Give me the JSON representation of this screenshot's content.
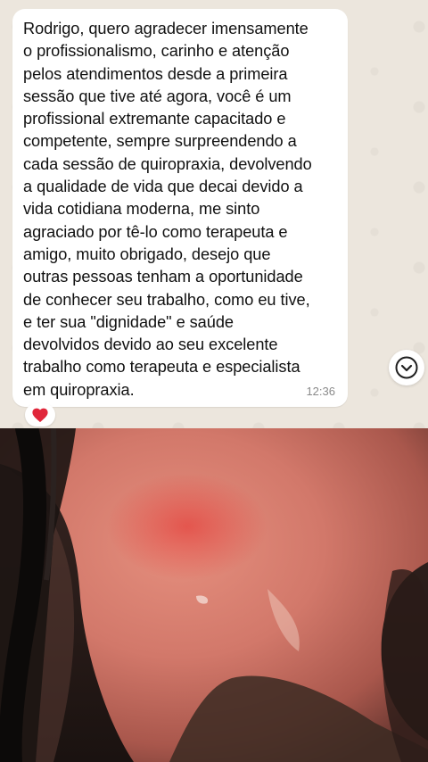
{
  "message": {
    "text": "Rodrigo, quero agradecer imensamente\no profissionalismo, carinho e atenção\npelos atendimentos desde a primeira\nsessão que tive até agora, você é um\nprofissional extremante capacitado e\ncompetente, sempre surpreendendo a\ncada sessão de quiropraxia, devolvendo\na qualidade de vida que decai devido a\nvida cotidiana moderna, me sinto\nagraciado por tê-lo como terapeuta e\namigo, muito obrigado, desejo que\noutras pessoas tenham a oportunidade\nde conhecer seu trabalho, como eu tive,\ne ter sua \"dignidade\" e saúde\ndevolvidos devido ao seu excelente\ntrabalho como terapeuta e especialista\nem quiropraxia.",
    "time": "12:36",
    "reaction": "heart",
    "reaction_color": "#e0263a"
  },
  "scroll_down_icon": "chevron-down-circle-icon",
  "colors": {
    "bubble": "#ffffff",
    "chat_background": "#ece6dd",
    "text": "#111111"
  }
}
